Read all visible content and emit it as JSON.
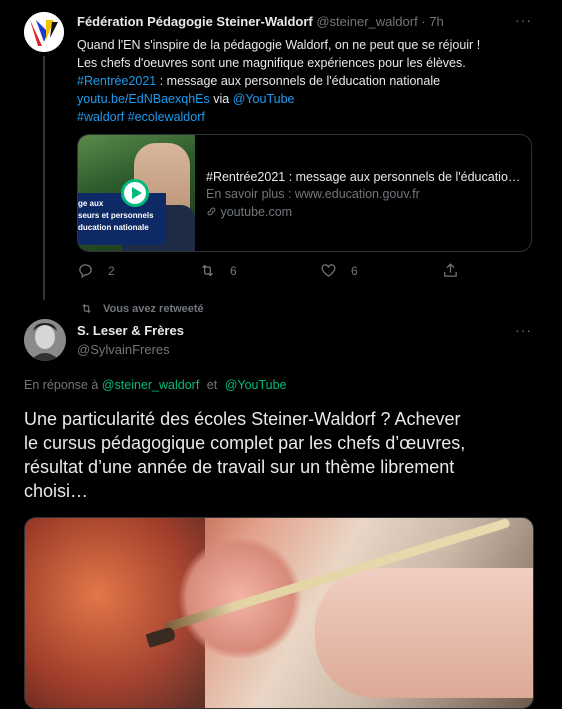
{
  "tweet1": {
    "author_name": "Fédération Pédagogie Steiner-Waldorf",
    "author_handle": "@steiner_waldorf",
    "time": "· 7h",
    "more": "···",
    "lines": [
      "Quand l'EN s'inspire de la pédagogie Waldorf, on ne peut que se réjouir !",
      "Les chefs d'oeuvres sont une magnifique expériences pour les élèves."
    ],
    "hashtag_line": {
      "tag": "#Rentrée2021",
      "text": " : message aux personnels de l'éducation nationale"
    },
    "link_line": {
      "link": "youtu.be/EdNBaexqhEs",
      "via": " via ",
      "mention": "@YouTube"
    },
    "tags_line": "#waldorf #ecolewaldorf",
    "card": {
      "title": "#Rentrée2021 : message aux personnels de l'éducation nationale",
      "subtitle": "En savoir plus : www.education.gouv.fr",
      "domain": "youtube.com",
      "thumb_lines": [
        "ge aux",
        "seurs et personnels",
        "ducation nationale"
      ]
    },
    "actions": {
      "reply_count": "2",
      "retweet_count": "6",
      "like_count": "6"
    }
  },
  "retweeted_label": "Vous avez retweeté",
  "tweet2": {
    "author_name": "S. Leser & Frères",
    "author_handle": "@SylvainFreres",
    "more": "···",
    "reply_prefix": "En réponse à",
    "reply_to_1": "@steiner_waldorf",
    "reply_and": "et",
    "reply_to_2": "@YouTube",
    "text_lines": [
      "Une particularité des écoles Steiner-Waldorf ? Achever",
      "le cursus pédagogique complet par les chefs d’œuvres,",
      "résultat d’une année de travail sur un thème librement",
      "choisi…"
    ]
  },
  "colors": {
    "background": "#000000",
    "link": "#1d9bf0",
    "secondary": "#71767b",
    "primary_text": "#e7e9ea"
  }
}
